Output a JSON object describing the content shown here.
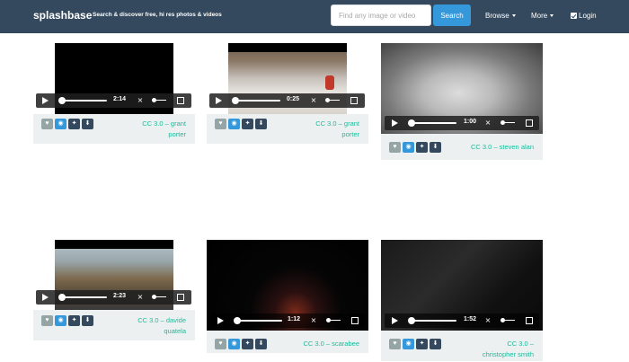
{
  "navbar": {
    "brand": "splashbase",
    "tagline": "Search & discover free, hi res photos & videos",
    "search_placeholder": "Find any image or video",
    "search_button": "Search",
    "browse": "Browse",
    "more": "More",
    "login": "Login"
  },
  "colors": {
    "navbar": "#34495e",
    "accent_blue": "#3498db",
    "credit_green": "#1abc9c",
    "card_footer": "#ecf0f1"
  },
  "cards": [
    {
      "time": "2:14",
      "license": "CC 3.0",
      "author": "grant porter",
      "credit_line1": "CC 3.0 – grant",
      "credit_line2": "porter",
      "preview": "black-video"
    },
    {
      "time": "0:25",
      "license": "CC 3.0",
      "author": "grant porter",
      "credit_line1": "CC 3.0 – grant",
      "credit_line2": "porter",
      "preview": "snow-river"
    },
    {
      "time": "1:00",
      "license": "CC 3.0",
      "author": "steven alan",
      "credit_line1": "CC 3.0 – steven alan",
      "credit_line2": "",
      "preview": "dog"
    },
    {
      "time": "2:23",
      "license": "CC 3.0",
      "author": "davide quatela",
      "credit_line1": "CC 3.0 – davide",
      "credit_line2": "quatela",
      "preview": "city-street"
    },
    {
      "time": "1:12",
      "license": "CC 3.0",
      "author": "scarabee",
      "credit_line1": "CC 3.0 – scarabee",
      "credit_line2": "",
      "preview": "fireworks"
    },
    {
      "time": "1:52",
      "license": "CC 3.0",
      "author": "christopher smith",
      "credit_line1": "CC 3.0 –",
      "credit_line2": "christopher smith",
      "preview": "flag-night"
    }
  ],
  "action_icons": [
    "heart-icon",
    "eye-icon",
    "twitter-icon",
    "download-icon"
  ]
}
